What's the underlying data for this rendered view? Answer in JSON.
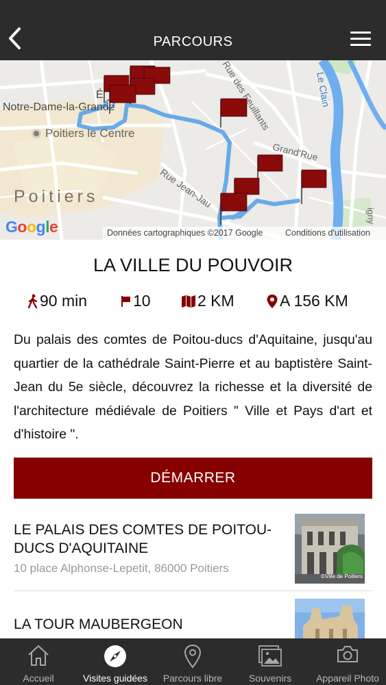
{
  "header": {
    "title": "PARCOURS",
    "back_icon": "chevron-left-icon",
    "menu_icon": "hamburger-menu-icon"
  },
  "map": {
    "labels": {
      "notre_dame": "Notre-Dame-la-Grande",
      "poitiers_centre": "Poitiers le Centre",
      "poitiers": "Poitiers",
      "feuillants": "Rue des Feuillants",
      "grand_rue": "Grand'Rue",
      "jean_jaures": "Rue Jean-Jau",
      "le_clain": "Le Clain",
      "cathedral_fragment": "É",
      "edge_fragment": "igny"
    },
    "google_logo": "Google",
    "attribution": "Données cartographiques ©2017 Google",
    "terms": "Conditions d'utilisation",
    "route_color": "#5aa3e8",
    "flag_color": "#8b0a0a"
  },
  "route": {
    "title": "LA VILLE DU POUVOIR",
    "duration": "90 min",
    "stops": "10",
    "distance": "2 KM",
    "proximity": "A 156 KM",
    "description": "Du palais des comtes de Poitou-ducs d'Aquitaine, jusqu'au quartier de la cathédrale Saint-Pierre et au baptistère Saint-Jean du 5e siècle, découvrez la richesse et la diversité de l'architecture médiévale de Poitiers \" Ville et Pays d'art et d'histoire \".",
    "start_label": "DÉMARRER",
    "accent_color": "#870000"
  },
  "places": [
    {
      "name": "LE PALAIS DES COMTES DE POITOU-DUCS D'AQUITAINE",
      "address": "10 place Alphonse-Lepetit, 86000 Poitiers",
      "photo_credit": "©Ville de Poitiers"
    },
    {
      "name": "LA TOUR MAUBERGEON",
      "address": "",
      "photo_credit": ""
    }
  ],
  "tabbar": {
    "items": [
      {
        "label": "Accueil",
        "icon": "home-icon",
        "active": false
      },
      {
        "label": "Visites guidées",
        "icon": "compass-icon",
        "active": true
      },
      {
        "label": "Parcours libre",
        "icon": "map-pin-icon",
        "active": false
      },
      {
        "label": "Souvenirs",
        "icon": "photo-gallery-icon",
        "active": false
      },
      {
        "label": "Appareil Photo",
        "icon": "camera-icon",
        "active": false
      }
    ]
  }
}
